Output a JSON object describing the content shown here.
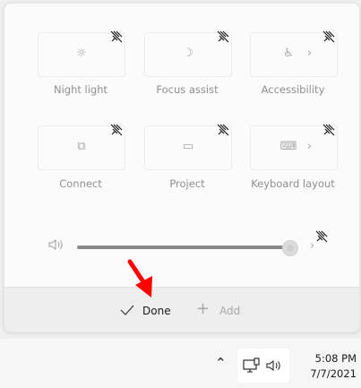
{
  "quick_settings": {
    "tiles": [
      {
        "label": "Night light",
        "icon": "brightness-icon",
        "glyph": "☼",
        "has_chevron": false
      },
      {
        "label": "Focus assist",
        "icon": "moon-icon",
        "glyph": "☽",
        "has_chevron": false
      },
      {
        "label": "Accessibility",
        "icon": "accessibility-icon",
        "glyph": "♿",
        "has_chevron": true
      },
      {
        "label": "Connect",
        "icon": "cast-icon",
        "glyph": "⧉",
        "has_chevron": false
      },
      {
        "label": "Project",
        "icon": "project-icon",
        "glyph": "▭",
        "has_chevron": false
      },
      {
        "label": "Keyboard layout",
        "icon": "keyboard-icon",
        "glyph": "⌨",
        "has_chevron": true
      }
    ],
    "chevron_glyph": "›",
    "volume": {
      "icon": "speaker-icon",
      "level_percent": 100
    },
    "footer": {
      "done_label": "Done",
      "add_label": "Add"
    }
  },
  "taskbar": {
    "time": "5:08 PM",
    "date": "7/7/2021"
  },
  "colors": {
    "annotation_arrow": "#ff0000",
    "panel_bg": "#fbfbfb",
    "footer_bg": "#eeeeee"
  }
}
